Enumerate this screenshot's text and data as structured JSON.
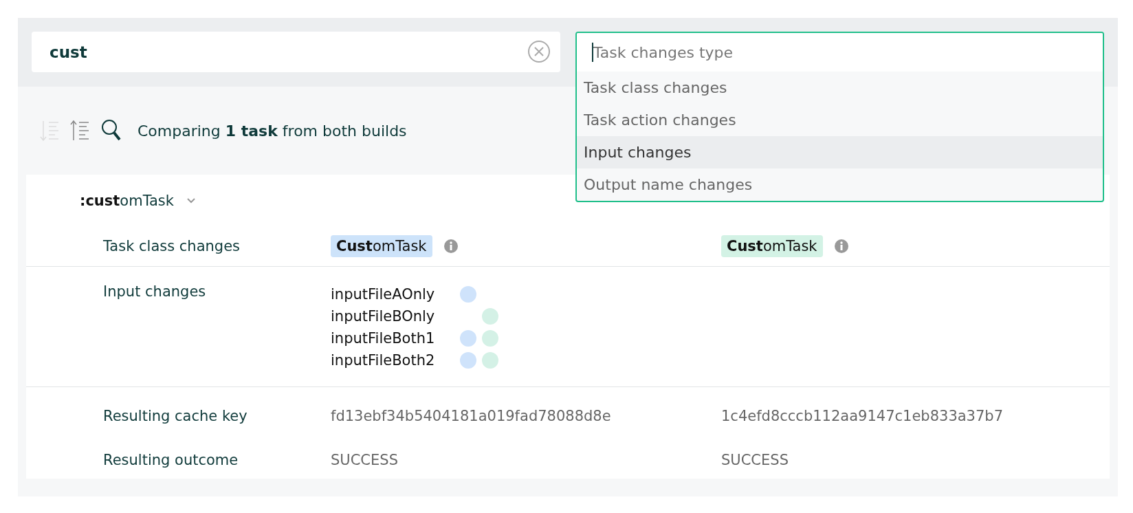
{
  "search": {
    "value": "cust"
  },
  "type_filter": {
    "placeholder": "Task changes type",
    "options": [
      {
        "label": "Task class changes",
        "highlighted": false
      },
      {
        "label": "Task action changes",
        "highlighted": false
      },
      {
        "label": "Input changes",
        "highlighted": true
      },
      {
        "label": "Output name changes",
        "highlighted": false
      }
    ]
  },
  "toolbar": {
    "sort_buttons": [
      {
        "kind": "descending",
        "disabled": true
      },
      {
        "kind": "ascending",
        "disabled": false
      }
    ],
    "summary": "Comparing **1 task** from both builds"
  },
  "task": {
    "name": "**:cust**omTask",
    "expanded": true,
    "class_changes": {
      "label": "Task class changes",
      "build_a": "**Cust**omTask",
      "build_b": "**Cust**omTask"
    },
    "input_changes": {
      "label": "Input changes",
      "inputs": [
        {
          "name": "inputFileAOnly",
          "in_a": true,
          "in_b": false
        },
        {
          "name": "inputFileBOnly",
          "in_a": false,
          "in_b": true
        },
        {
          "name": "inputFileBoth1",
          "in_a": true,
          "in_b": true
        },
        {
          "name": "inputFileBoth2",
          "in_a": true,
          "in_b": true
        }
      ]
    },
    "rows": [
      {
        "label": "Resulting cache key",
        "build_a": "fd13ebf34b5404181a019fad78088d8e",
        "build_b": "1c4efd8cccb112aa9147c1eb833a37b7"
      },
      {
        "label": "Resulting outcome",
        "build_a": "SUCCESS",
        "build_b": "SUCCESS"
      }
    ]
  }
}
